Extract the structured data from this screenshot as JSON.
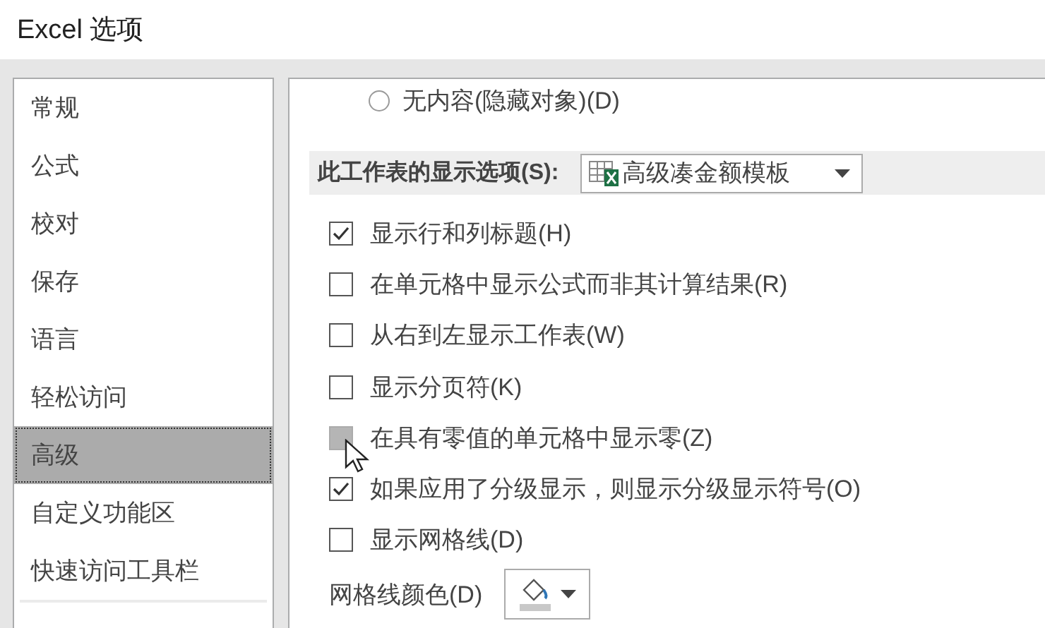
{
  "window": {
    "title": "Excel 选项"
  },
  "sidebar": {
    "items": [
      {
        "label": "常规",
        "selected": false
      },
      {
        "label": "公式",
        "selected": false
      },
      {
        "label": "校对",
        "selected": false
      },
      {
        "label": "保存",
        "selected": false
      },
      {
        "label": "语言",
        "selected": false
      },
      {
        "label": "轻松访问",
        "selected": false
      },
      {
        "label": "高级",
        "selected": true
      },
      {
        "label": "自定义功能区",
        "selected": false
      },
      {
        "label": "快速访问工具栏",
        "selected": false
      }
    ]
  },
  "content": {
    "radio": {
      "label": "无内容(隐藏对象)(D)",
      "selected": false
    },
    "section": {
      "label": "此工作表的显示选项(S):",
      "dropdown": {
        "value": "高级凑金额模板"
      }
    },
    "options": [
      {
        "label": "显示行和列标题(H)",
        "checked": true,
        "highlighted": false
      },
      {
        "label": "在单元格中显示公式而非其计算结果(R)",
        "checked": false,
        "highlighted": false
      },
      {
        "label": "从右到左显示工作表(W)",
        "checked": false,
        "highlighted": false
      },
      {
        "label": "显示分页符(K)",
        "checked": false,
        "highlighted": false
      },
      {
        "label": "在具有零值的单元格中显示零(Z)",
        "checked": false,
        "highlighted": true
      },
      {
        "label": "如果应用了分级显示，则显示分级显示符号(O)",
        "checked": true,
        "highlighted": false
      },
      {
        "label": "显示网格线(D)",
        "checked": false,
        "highlighted": false
      }
    ],
    "gridline_color": {
      "label": "网格线颜色(D)"
    }
  }
}
